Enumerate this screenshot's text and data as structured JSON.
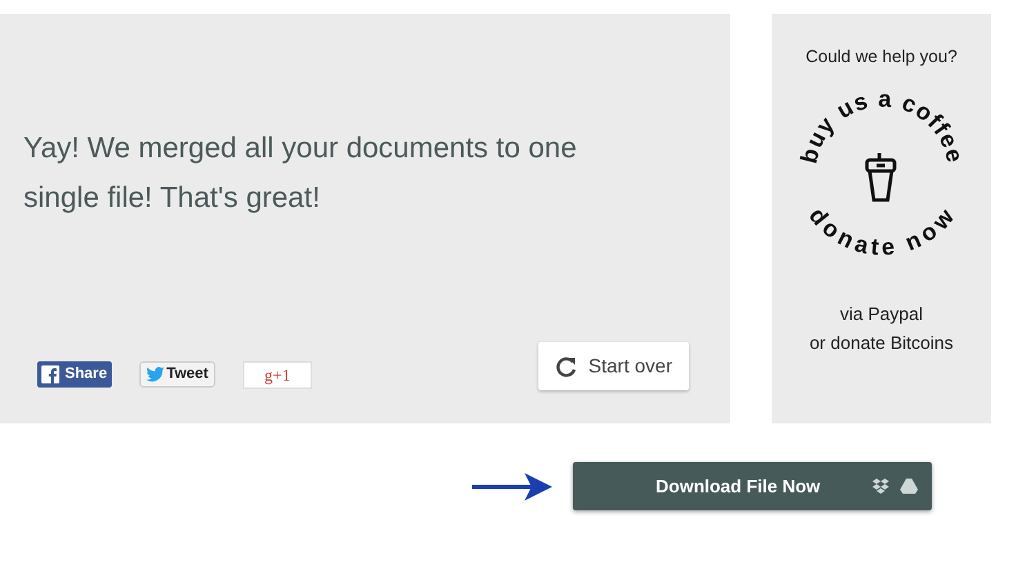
{
  "message": "Yay! We merged all your documents to one single file! That's great!",
  "social_buttons": [
    {
      "kind": "facebook",
      "label": "Share"
    },
    {
      "kind": "twitter",
      "label": "Tweet"
    },
    {
      "kind": "gplus",
      "label": "g+1"
    }
  ],
  "start_over": "Start over",
  "sidebar": {
    "title": "Could we help you?",
    "badge_top": "buy us a coffee",
    "badge_bottom": "donate now",
    "lines": [
      "via Paypal",
      "or donate Bitcoins"
    ]
  },
  "download_button": "Download File Now"
}
